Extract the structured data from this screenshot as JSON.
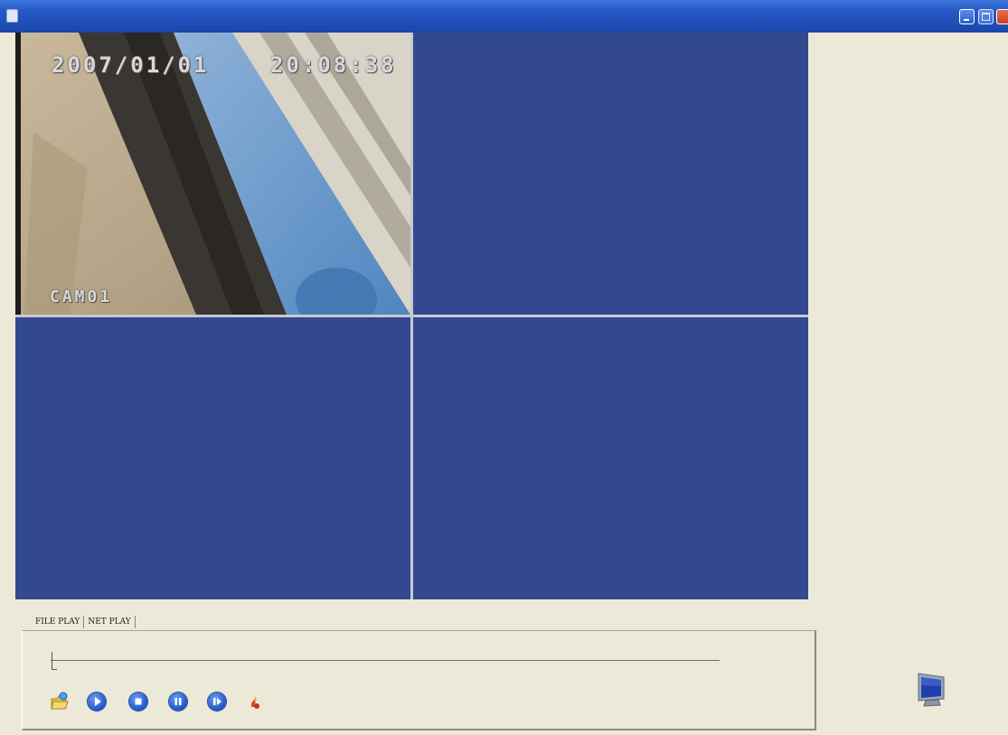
{
  "window": {
    "title": "",
    "accent_color": "#2759c8",
    "icons": [
      "app-icon",
      "minimize-icon",
      "maximize-icon",
      "close-icon"
    ]
  },
  "video": {
    "layout": "2x2",
    "channel1": {
      "date": "2007/01/01",
      "time": "20:08:38",
      "camera_label": "CAM01"
    },
    "empty_channel_color": "#33498f"
  },
  "player": {
    "tabs": [
      "FILE PLAY",
      "NET PLAY"
    ],
    "active_tab": "FILE PLAY",
    "seek_position": 0,
    "controls": [
      "open-file-icon",
      "play-icon",
      "stop-icon",
      "pause-icon",
      "step-forward-icon",
      "snapshot-icon"
    ]
  },
  "side_panel": {
    "icon": "monitor-icon"
  }
}
